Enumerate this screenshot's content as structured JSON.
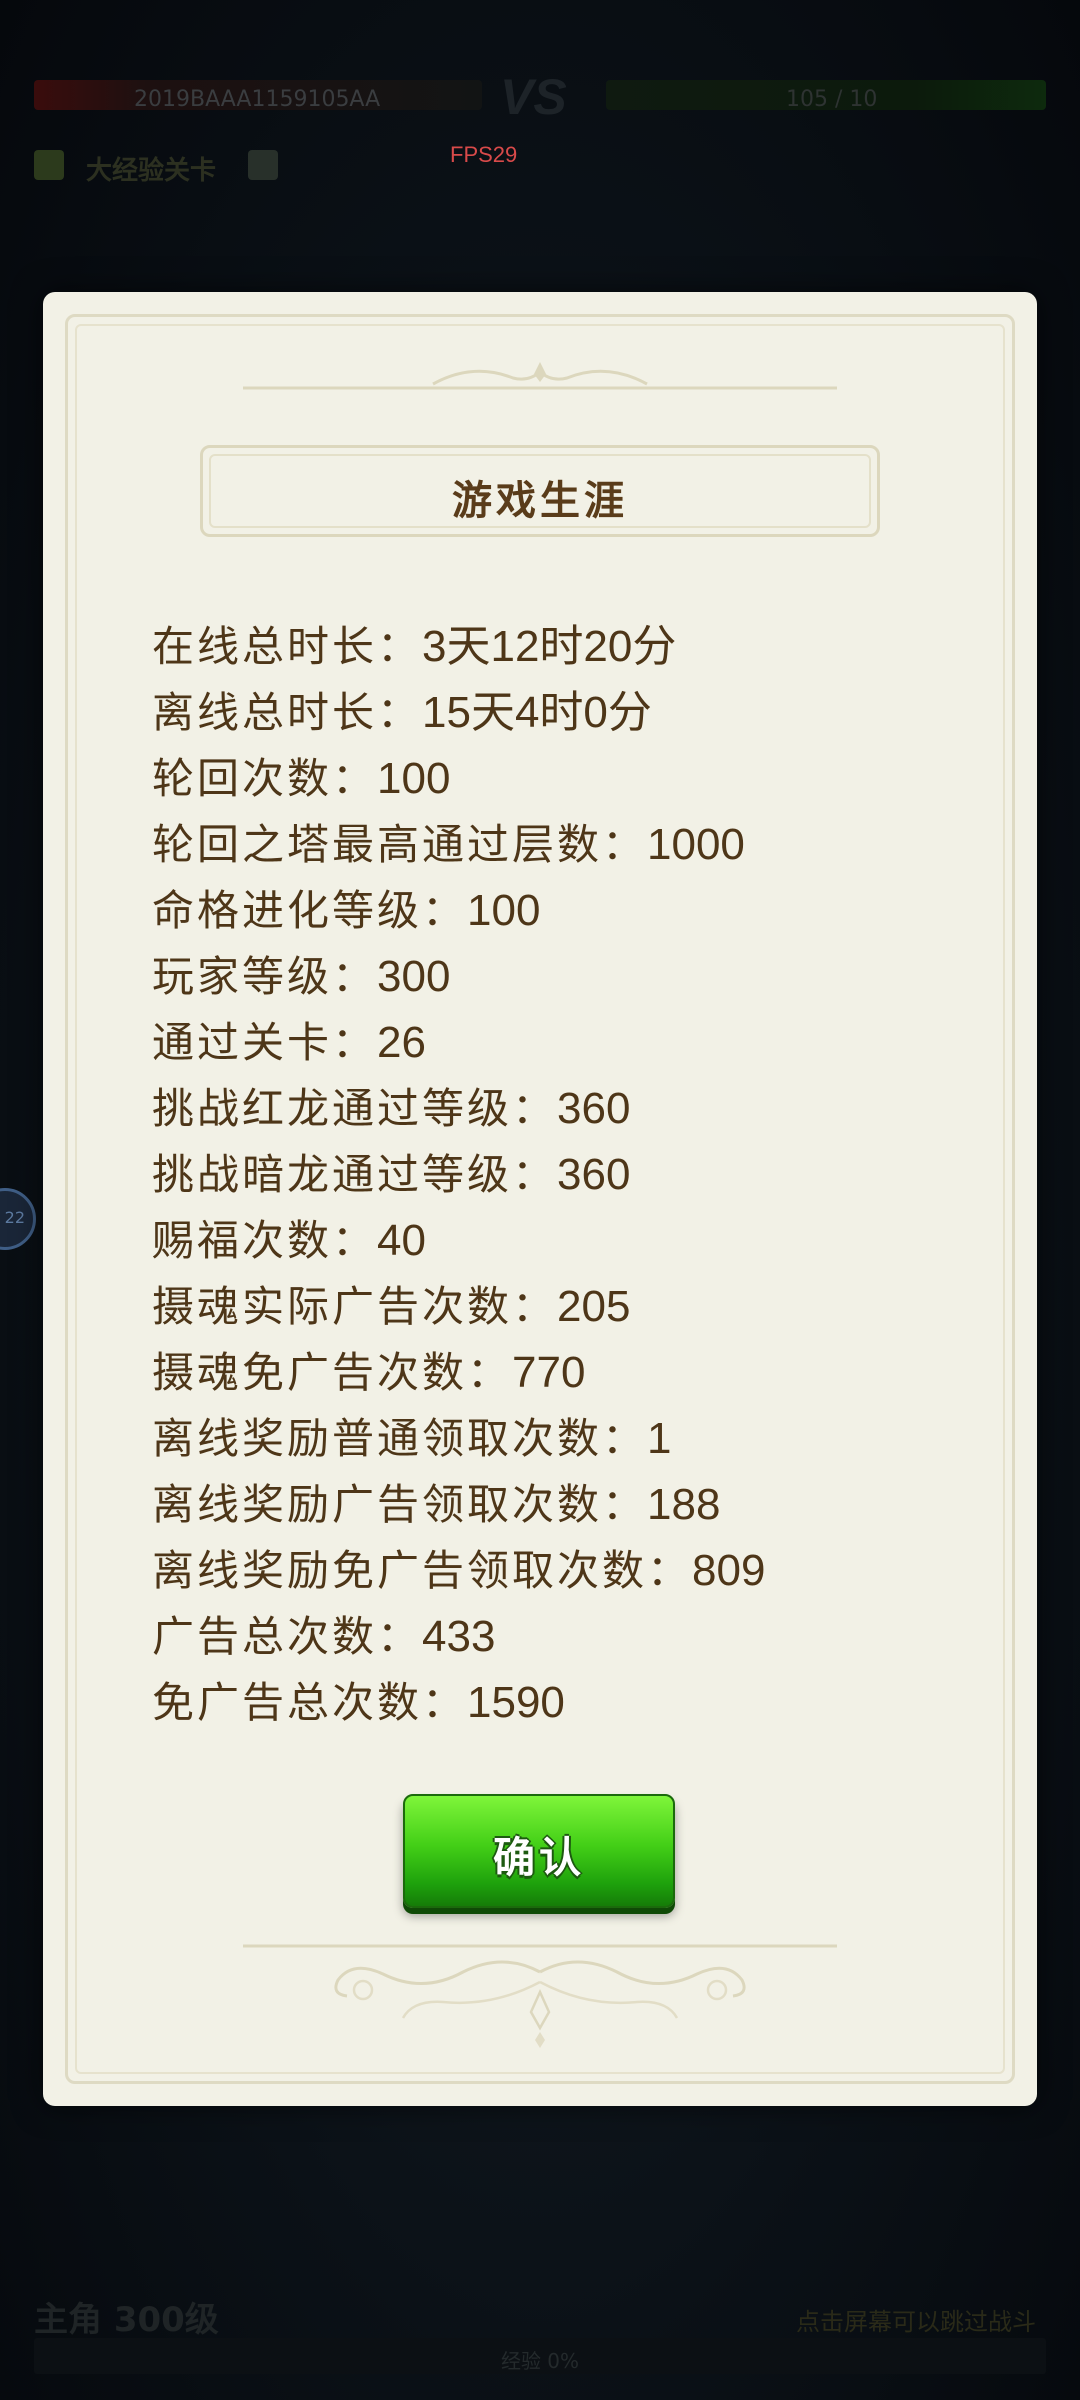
{
  "background": {
    "player_name": "2019BAAA1159105AA",
    "vs_label": "VS",
    "opponent_hp": "105 / 10",
    "level_label": "大经验关卡",
    "fps": "FPS29",
    "side_badge_number": "22",
    "bottom_left": "主角 300级",
    "bottom_right": "点击屏幕可以跳过战斗",
    "exp_bar": "经验 0%"
  },
  "modal": {
    "title": "游戏生涯",
    "stats": [
      {
        "label": "在线总时长：",
        "value": "3天12时20分"
      },
      {
        "label": "离线总时长：",
        "value": "15天4时0分"
      },
      {
        "label": "轮回次数：",
        "value": "100"
      },
      {
        "label": "轮回之塔最高通过层数：",
        "value": "1000"
      },
      {
        "label": "命格进化等级：",
        "value": "100"
      },
      {
        "label": "玩家等级：",
        "value": "300"
      },
      {
        "label": "通过关卡：",
        "value": "26"
      },
      {
        "label": "挑战红龙通过等级：",
        "value": "360"
      },
      {
        "label": "挑战暗龙通过等级：",
        "value": "360"
      },
      {
        "label": "赐福次数：",
        "value": "40"
      },
      {
        "label": "摄魂实际广告次数：",
        "value": "205"
      },
      {
        "label": "摄魂免广告次数：",
        "value": "770"
      },
      {
        "label": "离线奖励普通领取次数：",
        "value": "1"
      },
      {
        "label": "离线奖励广告领取次数：",
        "value": "188"
      },
      {
        "label": "离线奖励免广告领取次数：",
        "value": "809"
      },
      {
        "label": "广告总次数：",
        "value": "433"
      },
      {
        "label": "免广告总次数：",
        "value": "1590"
      }
    ],
    "confirm_label": "确认"
  },
  "colors": {
    "modal_bg": "#f2f1e6",
    "text_brown": "#4e3618",
    "title_brown": "#5a3c1a",
    "button_green": "#43cf17",
    "fps_red": "#d84a4a"
  }
}
